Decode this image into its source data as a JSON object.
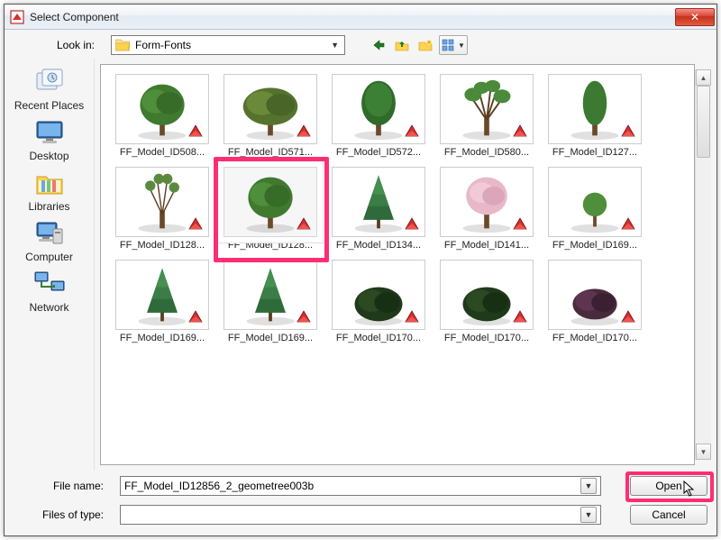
{
  "window": {
    "title": "Select Component",
    "close_glyph": "✕"
  },
  "toolbar": {
    "lookin_label": "Look in:",
    "folder_name": "Form-Fonts",
    "back_icon": "back-arrow",
    "up_icon": "folder-up",
    "new_icon": "new-folder",
    "views_icon": "views"
  },
  "places": [
    {
      "id": "recent",
      "label": "Recent Places"
    },
    {
      "id": "desktop",
      "label": "Desktop"
    },
    {
      "id": "libraries",
      "label": "Libraries"
    },
    {
      "id": "computer",
      "label": "Computer"
    },
    {
      "id": "network",
      "label": "Network"
    }
  ],
  "files": [
    {
      "label": "FF_Model_ID508...",
      "tree": "green_round"
    },
    {
      "label": "FF_Model_ID571...",
      "tree": "green_broad"
    },
    {
      "label": "FF_Model_ID572...",
      "tree": "green_oval"
    },
    {
      "label": "FF_Model_ID580...",
      "tree": "green_open"
    },
    {
      "label": "FF_Model_ID127...",
      "tree": "green_narrow"
    },
    {
      "label": "FF_Model_ID128...",
      "tree": "green_sparse"
    },
    {
      "label": "FF_Model_ID128...",
      "tree": "green_round",
      "selected": true
    },
    {
      "label": "FF_Model_ID134...",
      "tree": "conifer"
    },
    {
      "label": "FF_Model_ID141...",
      "tree": "pink"
    },
    {
      "label": "FF_Model_ID169...",
      "tree": "small_green"
    },
    {
      "label": "FF_Model_ID169...",
      "tree": "conifer"
    },
    {
      "label": "FF_Model_ID169...",
      "tree": "conifer"
    },
    {
      "label": "FF_Model_ID170...",
      "tree": "bush_dark"
    },
    {
      "label": "FF_Model_ID170...",
      "tree": "bush_dark"
    },
    {
      "label": "FF_Model_ID170...",
      "tree": "bush_purple"
    }
  ],
  "bottom": {
    "filename_label": "File name:",
    "filetype_label": "Files of type:",
    "filename_value": "FF_Model_ID12856_2_geometree003b",
    "filetype_value": "",
    "open_label": "Open",
    "cancel_label": "Cancel"
  }
}
